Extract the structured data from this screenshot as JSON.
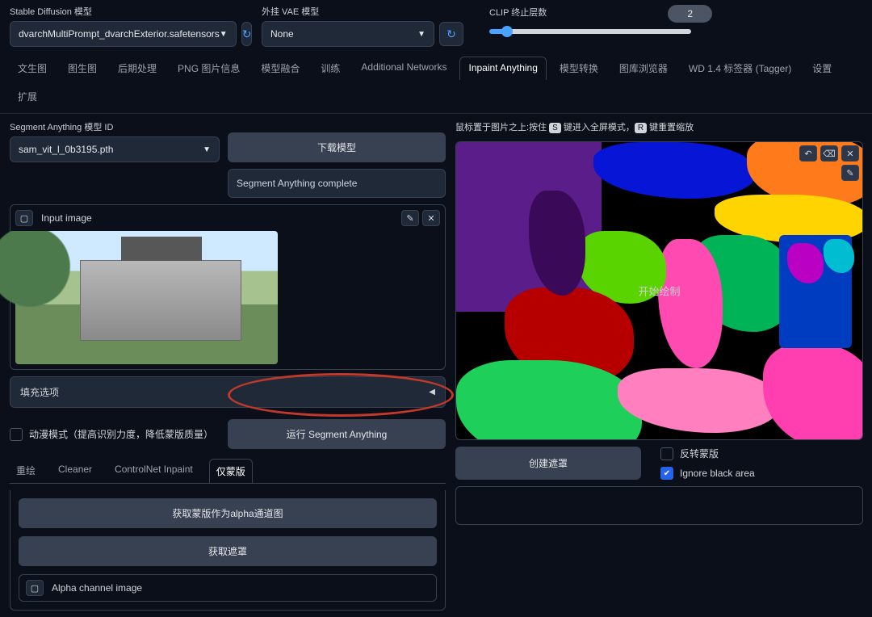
{
  "top": {
    "model_label": "Stable Diffusion 模型",
    "model_value": "dvarchMultiPrompt_dvarchExterior.safetensors",
    "vae_label": "外挂 VAE 模型",
    "vae_value": "None",
    "clip_label": "CLIP 终止层数",
    "clip_value": "2"
  },
  "tabs": [
    "文生图",
    "图生图",
    "后期处理",
    "PNG 图片信息",
    "模型融合",
    "训练",
    "Additional Networks",
    "Inpaint Anything",
    "模型转换",
    "图库浏览器",
    "WD 1.4 标签器 (Tagger)",
    "设置",
    "扩展"
  ],
  "active_tab_index": 7,
  "left": {
    "sam_model_label": "Segment Anything 模型 ID",
    "sam_model_value": "sam_vit_l_0b3195.pth",
    "download_button": "下载模型",
    "status_text": "Segment Anything complete",
    "input_image_label": "Input image",
    "fill_options_label": "填充选项",
    "anime_mode_label": "动漫模式（提高识别力度，降低蒙版质量）",
    "run_button": "运行 Segment Anything",
    "sub_tabs": [
      "重绘",
      "Cleaner",
      "ControlNet Inpaint",
      "仅蒙版"
    ],
    "active_sub_tab_index": 3,
    "get_alpha_button": "获取蒙版作为alpha通道图",
    "get_mask_button": "获取遮罩",
    "alpha_image_label": "Alpha channel image"
  },
  "right": {
    "hint_prefix": "鼠标置于图片之上:按住 ",
    "hint_key1": "S",
    "hint_mid": " 键进入全屏模式，",
    "hint_key2": "R",
    "hint_suffix": " 键重置缩放",
    "canvas_center_text": "开始绘制",
    "create_mask_button": "创建遮罩",
    "invert_mask_label": "反转蒙版",
    "ignore_black_label": "Ignore black area"
  }
}
